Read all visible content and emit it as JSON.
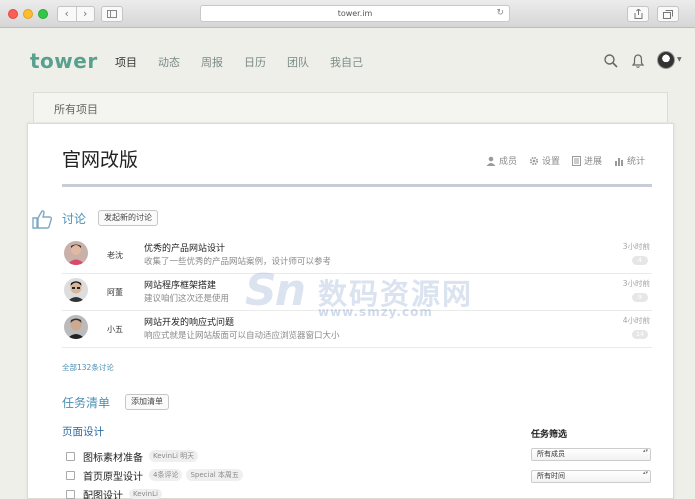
{
  "browser": {
    "url": "tower.im"
  },
  "header": {
    "logo": "tower",
    "nav": [
      {
        "label": "项目",
        "active": true
      },
      {
        "label": "动态",
        "active": false
      },
      {
        "label": "周报",
        "active": false
      },
      {
        "label": "日历",
        "active": false
      },
      {
        "label": "团队",
        "active": false
      },
      {
        "label": "我自己",
        "active": false
      }
    ]
  },
  "breadcrumb": "所有项目",
  "project": {
    "title": "官网改版",
    "actions": [
      {
        "label": "成员",
        "icon": "member-icon"
      },
      {
        "label": "设置",
        "icon": "gear-icon"
      },
      {
        "label": "进展",
        "icon": "progress-icon"
      },
      {
        "label": "统计",
        "icon": "stats-icon"
      }
    ]
  },
  "discussions": {
    "title": "讨论",
    "new_button": "发起新的讨论",
    "items": [
      {
        "author": "老沈",
        "title": "优秀的产品网站设计",
        "excerpt": "收集了一些优秀的产品网站案例，设计师可以参考",
        "time": "3小时前",
        "count": "4"
      },
      {
        "author": "阿董",
        "title": "网站程序框架搭建",
        "excerpt": "建议咱们这次还是使用",
        "time": "3小时前",
        "count": "9"
      },
      {
        "author": "小五",
        "title": "网站开发的响应式问题",
        "excerpt": "响应式就是让网站版面可以自动适应浏览器窗口大小",
        "time": "4小时前",
        "count": "14"
      }
    ],
    "all_link": "全部132条讨论"
  },
  "todolists": {
    "title": "任务清单",
    "add_button": "添加清单",
    "list": {
      "name": "页面设计",
      "todos": [
        {
          "text": "图标素材准备",
          "tags": [
            "KevinLi 明天"
          ]
        },
        {
          "text": "首页原型设计",
          "tags": [
            "4条评论",
            "Special 本周五"
          ]
        },
        {
          "text": "配图设计",
          "tags": [
            "KevinLi"
          ]
        }
      ]
    },
    "filter": {
      "title": "任务筛选",
      "member_select": "所有成员",
      "time_select": "所有时间"
    }
  },
  "watermark": {
    "logo": "Sn",
    "text": "数码资源网",
    "url": "www.smzy.com"
  },
  "colors": {
    "brand": "#5aa08f",
    "link": "#4a8fb5",
    "background": "#efefe9"
  }
}
